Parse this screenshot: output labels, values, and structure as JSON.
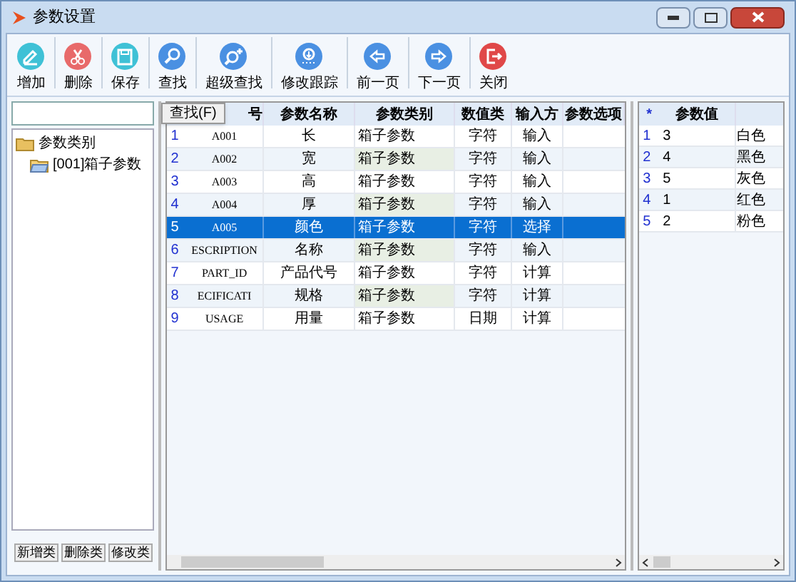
{
  "window": {
    "title": "参数设置"
  },
  "toolbar": [
    {
      "label": "增加",
      "kind": "add"
    },
    {
      "label": "删除",
      "kind": "delete"
    },
    {
      "label": "保存",
      "kind": "save"
    },
    {
      "label": "查找",
      "kind": "find"
    },
    {
      "label": "超级查找",
      "kind": "superfind"
    },
    {
      "label": "修改跟踪",
      "kind": "track"
    },
    {
      "label": "前一页",
      "kind": "prev"
    },
    {
      "label": "下一页",
      "kind": "next"
    },
    {
      "label": "关闭",
      "kind": "close"
    }
  ],
  "tree": {
    "label": "参数类别",
    "expanded": true,
    "children": [
      {
        "label": "[001]箱子参数"
      }
    ]
  },
  "left_buttons": [
    "新增类",
    "删除类",
    "修改类"
  ],
  "tooltip": "查找(F)",
  "main_table": {
    "columns": [
      "号",
      "参数名称",
      "参数类别",
      "数值类",
      "输入方",
      "参数选项"
    ],
    "rows": [
      {
        "num": "1",
        "cells": [
          "A001",
          "长",
          "箱子参数",
          "字符",
          "输入"
        ],
        "selected": false
      },
      {
        "num": "2",
        "cells": [
          "A002",
          "宽",
          "箱子参数",
          "字符",
          "输入"
        ],
        "selected": false
      },
      {
        "num": "3",
        "cells": [
          "A003",
          "高",
          "箱子参数",
          "字符",
          "输入"
        ],
        "selected": false
      },
      {
        "num": "4",
        "cells": [
          "A004",
          "厚",
          "箱子参数",
          "字符",
          "输入"
        ],
        "selected": false
      },
      {
        "num": "5",
        "cells": [
          "A005",
          "颜色",
          "箱子参数",
          "字符",
          "选择"
        ],
        "selected": true
      },
      {
        "num": "6",
        "cells": [
          "ESCRIPTION",
          "名称",
          "箱子参数",
          "字符",
          "输入"
        ],
        "selected": false
      },
      {
        "num": "7",
        "cells": [
          "PART_ID",
          "产品代号",
          "箱子参数",
          "字符",
          "计算"
        ],
        "selected": false
      },
      {
        "num": "8",
        "cells": [
          "ECIFICATI",
          "规格",
          "箱子参数",
          "字符",
          "计算"
        ],
        "selected": false
      },
      {
        "num": "9",
        "cells": [
          "USAGE",
          "用量",
          "箱子参数",
          "日期",
          "计算"
        ],
        "selected": false
      }
    ]
  },
  "value_table": {
    "columns": [
      "*",
      "参数值"
    ],
    "rows": [
      {
        "num": "1",
        "value": "3",
        "name": "白色"
      },
      {
        "num": "2",
        "value": "4",
        "name": "黑色"
      },
      {
        "num": "3",
        "value": "5",
        "name": "灰色"
      },
      {
        "num": "4",
        "value": "1",
        "name": "红色"
      },
      {
        "num": "5",
        "value": "2",
        "name": "粉色"
      }
    ]
  }
}
